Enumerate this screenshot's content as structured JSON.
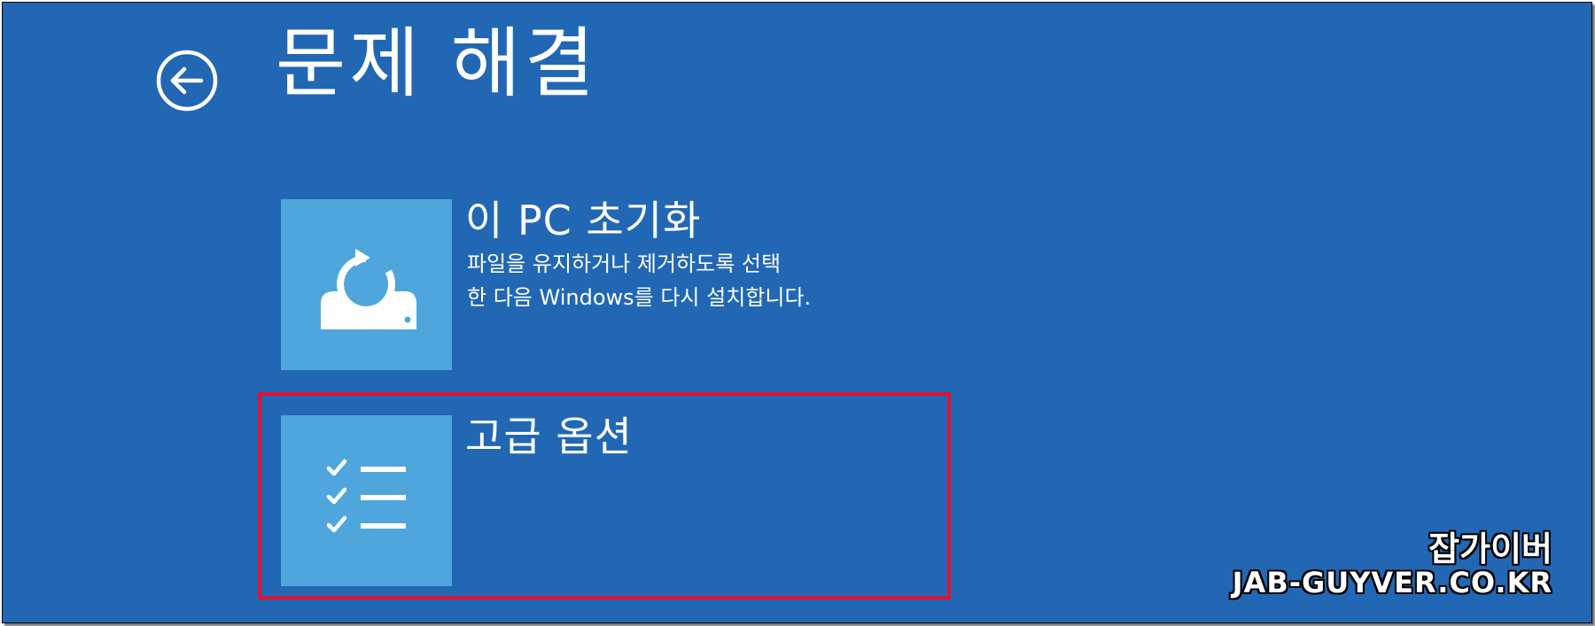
{
  "header": {
    "title": "문제 해결",
    "back_icon": "back-arrow-circle-icon"
  },
  "options": [
    {
      "title": "이 PC 초기화",
      "description_line1": "파일을 유지하거나 제거하도록 선택",
      "description_line2": "한 다음 Windows를 다시 설치합니다.",
      "icon": "reset-pc-icon"
    },
    {
      "title": "고급 옵션",
      "icon": "checklist-icon",
      "highlighted": true
    }
  ],
  "watermark": {
    "line1": "잡가이버",
    "line2": "JAB-GUYVER.CO.KR"
  },
  "colors": {
    "background": "#2167b4",
    "tile": "#4ea6dc",
    "text": "#ffffff",
    "highlight": "#e8102e"
  }
}
